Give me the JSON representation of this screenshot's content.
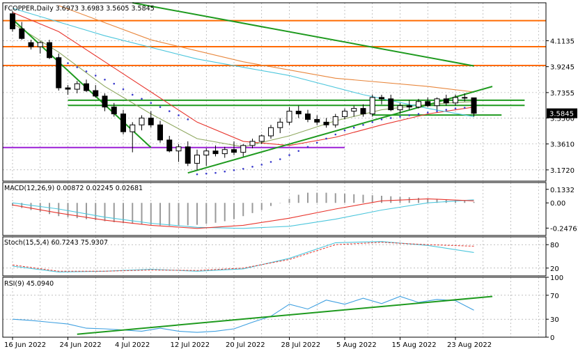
{
  "chart_data": [
    {
      "type": "candlestick",
      "header": "FCOPPER,Daily  3.6973 3.6983 3.5605 3.5845",
      "price_ticks": [
        "4.1135",
        "3.9245",
        "3.7355",
        "3.5500",
        "3.3610",
        "3.1720"
      ],
      "price_tick_values": [
        4.1135,
        3.9245,
        3.7355,
        3.55,
        3.361,
        3.172
      ],
      "current_price_label": "3.5845",
      "current_price": 3.5845,
      "y_range": [
        3.09,
        4.39
      ],
      "date_labels": [
        "16 Jun 2022",
        "24 Jun 2022",
        "4 Jul 2022",
        "12 Jul 2022",
        "20 Jul 2022",
        "28 Jul 2022",
        "5 Aug 2022",
        "15 Aug 2022",
        "23 Aug 2022"
      ],
      "date_label_bar_index": [
        0,
        6,
        12,
        18,
        24,
        30,
        36,
        42,
        48
      ],
      "bars": [
        [
          4.31,
          4.33,
          4.18,
          4.2
        ],
        [
          4.2,
          4.25,
          4.12,
          4.13
        ],
        [
          4.1,
          4.12,
          4.05,
          4.07
        ],
        [
          4.07,
          4.11,
          4.02,
          4.1
        ],
        [
          4.1,
          4.12,
          3.98,
          3.99
        ],
        [
          3.99,
          4.02,
          3.75,
          3.77
        ],
        [
          3.77,
          3.79,
          3.72,
          3.76
        ],
        [
          3.76,
          3.82,
          3.73,
          3.8
        ],
        [
          3.8,
          3.83,
          3.74,
          3.75
        ],
        [
          3.75,
          3.79,
          3.7,
          3.71
        ],
        [
          3.71,
          3.73,
          3.6,
          3.63
        ],
        [
          3.63,
          3.66,
          3.56,
          3.58
        ],
        [
          3.58,
          3.61,
          3.43,
          3.45
        ],
        [
          3.45,
          3.52,
          3.3,
          3.5
        ],
        [
          3.5,
          3.57,
          3.46,
          3.55
        ],
        [
          3.55,
          3.6,
          3.48,
          3.5
        ],
        [
          3.5,
          3.53,
          3.37,
          3.39
        ],
        [
          3.39,
          3.42,
          3.3,
          3.31
        ],
        [
          3.31,
          3.36,
          3.23,
          3.34
        ],
        [
          3.34,
          3.38,
          3.2,
          3.22
        ],
        [
          3.22,
          3.32,
          3.17,
          3.28
        ],
        [
          3.28,
          3.33,
          3.2,
          3.31
        ],
        [
          3.31,
          3.35,
          3.27,
          3.29
        ],
        [
          3.29,
          3.34,
          3.26,
          3.32
        ],
        [
          3.32,
          3.38,
          3.28,
          3.3
        ],
        [
          3.3,
          3.36,
          3.27,
          3.35
        ],
        [
          3.35,
          3.4,
          3.33,
          3.38
        ],
        [
          3.38,
          3.43,
          3.36,
          3.42
        ],
        [
          3.42,
          3.5,
          3.4,
          3.48
        ],
        [
          3.48,
          3.55,
          3.44,
          3.52
        ],
        [
          3.52,
          3.63,
          3.5,
          3.6
        ],
        [
          3.6,
          3.64,
          3.55,
          3.58
        ],
        [
          3.58,
          3.61,
          3.52,
          3.54
        ],
        [
          3.54,
          3.57,
          3.5,
          3.52
        ],
        [
          3.52,
          3.55,
          3.48,
          3.5
        ],
        [
          3.5,
          3.58,
          3.48,
          3.56
        ],
        [
          3.56,
          3.62,
          3.54,
          3.6
        ],
        [
          3.6,
          3.64,
          3.56,
          3.62
        ],
        [
          3.62,
          3.65,
          3.56,
          3.58
        ],
        [
          3.58,
          3.72,
          3.56,
          3.7
        ],
        [
          3.7,
          3.72,
          3.65,
          3.69
        ],
        [
          3.69,
          3.72,
          3.6,
          3.61
        ],
        [
          3.61,
          3.66,
          3.58,
          3.64
        ],
        [
          3.64,
          3.68,
          3.61,
          3.63
        ],
        [
          3.63,
          3.69,
          3.62,
          3.67
        ],
        [
          3.67,
          3.7,
          3.63,
          3.64
        ],
        [
          3.64,
          3.7,
          3.61,
          3.69
        ],
        [
          3.69,
          3.72,
          3.64,
          3.66
        ],
        [
          3.66,
          3.72,
          3.64,
          3.7
        ],
        [
          3.7,
          3.73,
          3.67,
          3.6973
        ],
        [
          3.6973,
          3.6983,
          3.5605,
          3.5845
        ]
      ],
      "horizontal_levels": [
        {
          "price": 4.26,
          "color": "#ff6a00"
        },
        {
          "price": 4.07,
          "color": "#ff6a00"
        },
        {
          "price": 3.933,
          "color": "#ff6a00"
        },
        {
          "price": 3.68,
          "color": "#1e9a1e"
        },
        {
          "price": 3.642,
          "color": "#1e9a1e"
        },
        {
          "price": 3.572,
          "color": "#1e9a1e"
        },
        {
          "price": 3.335,
          "color": "#9b1fd6"
        }
      ],
      "moving_averages": [
        {
          "color": "#e8352d",
          "points": [
            [
              0,
              4.32
            ],
            [
              5,
              4.18
            ],
            [
              10,
              3.96
            ],
            [
              15,
              3.74
            ],
            [
              20,
              3.52
            ],
            [
              25,
              3.38
            ],
            [
              30,
              3.35
            ],
            [
              35,
              3.41
            ],
            [
              40,
              3.5
            ],
            [
              45,
              3.58
            ],
            [
              50,
              3.63
            ]
          ]
        },
        {
          "color": "#8fa860",
          "points": [
            [
              0,
              4.24
            ],
            [
              5,
              4.03
            ],
            [
              10,
              3.78
            ],
            [
              15,
              3.58
            ],
            [
              20,
              3.4
            ],
            [
              25,
              3.34
            ],
            [
              30,
              3.42
            ],
            [
              35,
              3.53
            ],
            [
              40,
              3.61
            ],
            [
              45,
              3.65
            ],
            [
              50,
              3.67
            ]
          ]
        },
        {
          "color": "#4cc6dc",
          "points": [
            [
              0,
              4.35
            ],
            [
              10,
              4.15
            ],
            [
              20,
              3.98
            ],
            [
              30,
              3.86
            ],
            [
              38,
              3.72
            ],
            [
              45,
              3.62
            ],
            [
              50,
              3.56
            ]
          ]
        },
        {
          "color": "#e8863c",
          "points": [
            [
              5,
              4.37
            ],
            [
              15,
              4.12
            ],
            [
              25,
              3.96
            ],
            [
              35,
              3.84
            ],
            [
              45,
              3.78
            ],
            [
              50,
              3.74
            ]
          ]
        }
      ],
      "parabolic_sar": [
        [
          5,
          3.99
        ],
        [
          6,
          3.95
        ],
        [
          7,
          3.92
        ],
        [
          8,
          3.89
        ],
        [
          9,
          3.86
        ],
        [
          10,
          3.83
        ],
        [
          11,
          3.8
        ],
        [
          12,
          3.76
        ],
        [
          13,
          3.72
        ],
        [
          14,
          3.69
        ],
        [
          15,
          3.66
        ],
        [
          16,
          3.63
        ],
        [
          17,
          3.6
        ],
        [
          18,
          3.57
        ],
        [
          19,
          3.54
        ],
        [
          20,
          3.14
        ],
        [
          21,
          3.145
        ],
        [
          22,
          3.15
        ],
        [
          23,
          3.16
        ],
        [
          24,
          3.17
        ],
        [
          25,
          3.18
        ],
        [
          26,
          3.195
        ],
        [
          27,
          3.21
        ],
        [
          28,
          3.23
        ],
        [
          29,
          3.25
        ],
        [
          30,
          3.28
        ],
        [
          31,
          3.31
        ],
        [
          32,
          3.34
        ],
        [
          33,
          3.37
        ],
        [
          34,
          3.4
        ],
        [
          35,
          3.43
        ],
        [
          36,
          3.46
        ],
        [
          37,
          3.48
        ],
        [
          38,
          3.5
        ],
        [
          39,
          3.52
        ],
        [
          40,
          3.54
        ],
        [
          41,
          3.55
        ],
        [
          42,
          3.56
        ],
        [
          43,
          3.57
        ],
        [
          44,
          3.58
        ],
        [
          45,
          3.59
        ],
        [
          46,
          3.6
        ],
        [
          47,
          3.61
        ],
        [
          48,
          3.62
        ],
        [
          49,
          3.625
        ],
        [
          50,
          3.63
        ]
      ],
      "trendlines": [
        {
          "from": [
            13,
            4.39
          ],
          "to": [
            50,
            3.93
          ],
          "color": "#1e9a1e"
        },
        {
          "from": [
            0,
            4.27
          ],
          "to": [
            15,
            3.335
          ],
          "color": "#1e9a1e"
        },
        {
          "from": [
            19,
            3.15
          ],
          "to": [
            52,
            3.78
          ],
          "color": "#1e9a1e"
        }
      ]
    },
    {
      "type": "bar",
      "header": "MACD(12,26,9) 0.00872 0.02245 0.02681",
      "ticks": [
        "0.1332",
        "0.00",
        "-0.24761"
      ],
      "tick_values": [
        0.1332,
        0.0,
        -0.24761
      ],
      "y_range": [
        -0.32,
        0.2
      ],
      "histogram": [
        -0.03,
        -0.05,
        -0.07,
        -0.09,
        -0.11,
        -0.13,
        -0.14,
        -0.15,
        -0.16,
        -0.17,
        -0.18,
        -0.19,
        -0.2,
        -0.205,
        -0.21,
        -0.215,
        -0.22,
        -0.225,
        -0.225,
        -0.22,
        -0.215,
        -0.205,
        -0.195,
        -0.18,
        -0.16,
        -0.13,
        -0.1,
        -0.07,
        -0.03,
        0.0,
        0.04,
        0.08,
        0.1,
        0.1,
        0.1,
        0.095,
        0.09,
        0.085,
        0.08,
        0.075,
        0.07,
        0.065,
        0.06,
        0.055,
        0.05,
        0.045,
        0.04,
        0.035,
        0.03,
        0.025,
        0.01
      ],
      "signal": [
        [
          0,
          0.0
        ],
        [
          5,
          -0.06
        ],
        [
          10,
          -0.14
        ],
        [
          15,
          -0.2
        ],
        [
          20,
          -0.24
        ],
        [
          25,
          -0.25
        ],
        [
          30,
          -0.23
        ],
        [
          35,
          -0.16
        ],
        [
          40,
          -0.07
        ],
        [
          45,
          0.0
        ],
        [
          50,
          0.03
        ]
      ],
      "macd": [
        [
          0,
          -0.02
        ],
        [
          5,
          -0.1
        ],
        [
          10,
          -0.17
        ],
        [
          15,
          -0.22
        ],
        [
          20,
          -0.25
        ],
        [
          25,
          -0.22
        ],
        [
          30,
          -0.15
        ],
        [
          35,
          -0.06
        ],
        [
          40,
          0.02
        ],
        [
          45,
          0.04
        ],
        [
          50,
          0.02
        ]
      ],
      "signal_color": "#4cc6dc",
      "macd_color": "#e8352d"
    },
    {
      "type": "line",
      "header": "Stoch(15,5,4) 60.7243 75.9307",
      "ticks": [
        "80",
        "20"
      ],
      "tick_values": [
        80,
        20
      ],
      "y_range": [
        0,
        100
      ],
      "main": [
        [
          0,
          25
        ],
        [
          5,
          10
        ],
        [
          10,
          12
        ],
        [
          15,
          17
        ],
        [
          20,
          12
        ],
        [
          25,
          18
        ],
        [
          30,
          45
        ],
        [
          35,
          85
        ],
        [
          40,
          88
        ],
        [
          45,
          78
        ],
        [
          50,
          60
        ]
      ],
      "signal": [
        [
          0,
          28
        ],
        [
          5,
          12
        ],
        [
          10,
          12
        ],
        [
          15,
          15
        ],
        [
          20,
          14
        ],
        [
          25,
          20
        ],
        [
          30,
          42
        ],
        [
          35,
          80
        ],
        [
          40,
          86
        ],
        [
          45,
          80
        ],
        [
          50,
          76
        ]
      ],
      "main_color": "#4cc6dc",
      "signal_color": "#e8352d"
    },
    {
      "type": "line",
      "header": "RSI(9) 45.0940",
      "ticks": [
        "100",
        "70",
        "30",
        "0"
      ],
      "tick_values": [
        100,
        70,
        30,
        0
      ],
      "y_range": [
        0,
        100
      ],
      "rsi": [
        [
          0,
          30
        ],
        [
          2,
          28
        ],
        [
          4,
          25
        ],
        [
          6,
          22
        ],
        [
          8,
          15
        ],
        [
          10,
          14
        ],
        [
          12,
          12
        ],
        [
          14,
          10
        ],
        [
          16,
          15
        ],
        [
          18,
          10
        ],
        [
          20,
          8
        ],
        [
          22,
          10
        ],
        [
          24,
          14
        ],
        [
          26,
          25
        ],
        [
          28,
          35
        ],
        [
          30,
          55
        ],
        [
          32,
          47
        ],
        [
          34,
          62
        ],
        [
          36,
          55
        ],
        [
          38,
          65
        ],
        [
          40,
          56
        ],
        [
          42,
          68
        ],
        [
          44,
          58
        ],
        [
          46,
          63
        ],
        [
          48,
          61
        ],
        [
          50,
          45
        ]
      ],
      "rsi_color": "#3d9fe0",
      "trendline": {
        "from": [
          7,
          5
        ],
        "to": [
          52,
          68
        ],
        "color": "#1e9a1e"
      }
    }
  ]
}
